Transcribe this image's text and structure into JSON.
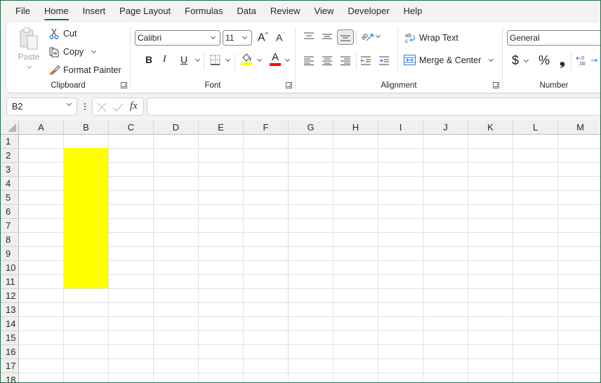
{
  "tabs": [
    "File",
    "Home",
    "Insert",
    "Page Layout",
    "Formulas",
    "Data",
    "Review",
    "View",
    "Developer",
    "Help"
  ],
  "active_tab": "Home",
  "clipboard": {
    "paste": "Paste",
    "cut": "Cut",
    "copy": "Copy",
    "format_painter": "Format Painter",
    "group_label": "Clipboard"
  },
  "font": {
    "font_name": "Calibri",
    "font_size": "11",
    "bold": "B",
    "italic": "I",
    "underline": "U",
    "group_label": "Font",
    "fill_color": "#ffff00",
    "font_color": "#ff0000"
  },
  "alignment": {
    "wrap_text": "Wrap Text",
    "merge_center": "Merge & Center",
    "group_label": "Alignment"
  },
  "number": {
    "format": "General",
    "currency": "$",
    "percent": "%",
    "comma": "❟",
    "group_label": "Number"
  },
  "formula_bar": {
    "name_box": "B2",
    "fx": "fx",
    "value": ""
  },
  "sheet": {
    "columns": [
      "A",
      "B",
      "C",
      "D",
      "E",
      "F",
      "G",
      "H",
      "I",
      "J",
      "K",
      "L",
      "M"
    ],
    "rows": [
      "1",
      "2",
      "3",
      "4",
      "5",
      "6",
      "7",
      "8",
      "9",
      "10",
      "11",
      "12",
      "13",
      "14",
      "15",
      "16",
      "17",
      "18"
    ],
    "highlighted_range": "B2:B11",
    "highlight_color": "#ffff00",
    "active_cell": "B2"
  },
  "colors": {
    "accent": "#1e7145"
  }
}
